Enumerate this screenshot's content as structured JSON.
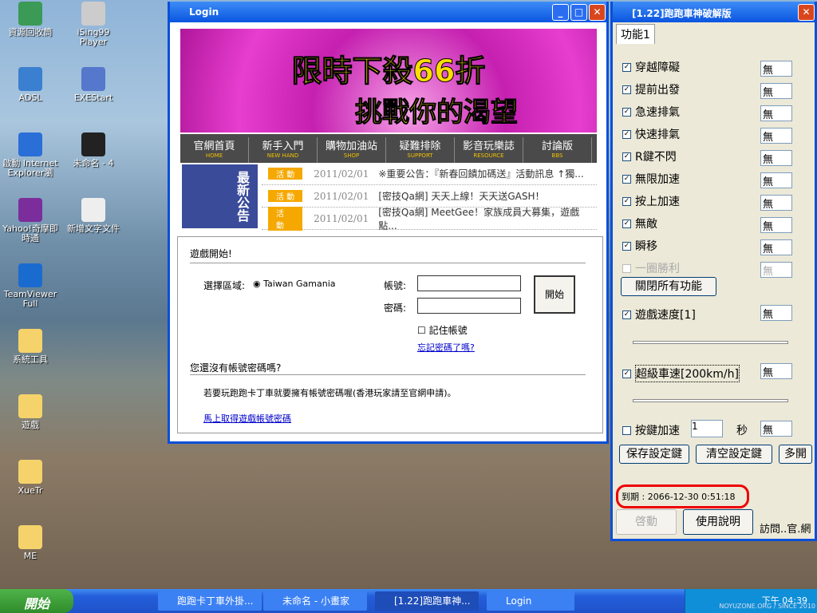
{
  "desktop_icons": [
    {
      "label": "資源回收筒"
    },
    {
      "label": "iSing99 Player"
    },
    {
      "label": "ADSL"
    },
    {
      "label": "EXEStart"
    },
    {
      "label": "啟動 Internet Explorer瀏"
    },
    {
      "label": "未命名 - 4"
    },
    {
      "label": "Yahoo!奇摩即時通"
    },
    {
      "label": "新增文字文件"
    },
    {
      "label": "TeamViewer Full"
    },
    {
      "label": "系統工具"
    },
    {
      "label": "遊戲"
    },
    {
      "label": "XueTr"
    },
    {
      "label": "ME"
    }
  ],
  "login": {
    "title": "Login",
    "banner_line1": "限時下殺66折",
    "banner_line2": "挑戰你的渴望",
    "nav": [
      {
        "zh": "官網首頁",
        "en": "HOME"
      },
      {
        "zh": "新手入門",
        "en": "NEW HAND"
      },
      {
        "zh": "購物加油站",
        "en": "SHOP"
      },
      {
        "zh": "疑難排除",
        "en": "SUPPORT"
      },
      {
        "zh": "影音玩樂誌",
        "en": "RESOURCE"
      },
      {
        "zh": "討論版",
        "en": "BBS"
      }
    ],
    "news_badge": "最新公告",
    "news": [
      {
        "tag": "活 動",
        "date": "2011/02/01",
        "text": "※重要公告：『新春回饋加碼送』活動訊息 ↑獨..."
      },
      {
        "tag": "活 動",
        "date": "2011/02/01",
        "text": "[密技Qa網] 天天上線！天天送GASH！"
      },
      {
        "tag": "活 動",
        "date": "2011/02/01",
        "text": "[密技Qa網] MeetGee！家族成員大募集，遊戲點..."
      }
    ],
    "section1": "遊戲開始!",
    "region_label": "選擇區域:",
    "region_value": "Taiwan Gamania",
    "account_label": "帳號:",
    "password_label": "密碼:",
    "start": "開始",
    "remember": "記住帳號",
    "forgot": "忘記密碼了嗎?",
    "section2": "您還沒有帳號密碼嗎?",
    "info": "若要玩跑跑卡丁車就要擁有帳號密碼喔(香港玩家請至官網申請)。",
    "signup": "馬上取得遊戲帳號密碼"
  },
  "tool": {
    "title": "[1.22]跑跑車神破解版",
    "tab": "功能1",
    "items": [
      {
        "label": "穿越障礙",
        "value": "無",
        "checked": true
      },
      {
        "label": "提前出發",
        "value": "無",
        "checked": true
      },
      {
        "label": "急速排氣",
        "value": "無",
        "checked": true
      },
      {
        "label": "快速排氣",
        "value": "無",
        "checked": true
      },
      {
        "label": "R鍵不閃",
        "value": "無",
        "checked": true
      },
      {
        "label": "無限加速",
        "value": "無",
        "checked": true
      },
      {
        "label": "按上加速",
        "value": "無",
        "checked": true
      },
      {
        "label": "無敵",
        "value": "無",
        "checked": true
      },
      {
        "label": "瞬移",
        "value": "無",
        "checked": true
      },
      {
        "label": "一圈勝利",
        "value": "無",
        "checked": false
      }
    ],
    "close_all": "關閉所有功能",
    "speed_label": "遊戲速度[1]",
    "speed_value": "無",
    "car_label": "超級車速[200km/h]",
    "car_value": "無",
    "key_label": "按鍵加速",
    "key_num": "1",
    "sec": "秒",
    "key_value": "無",
    "save": "保存設定鍵",
    "clear": "清空設定鍵",
    "multi": "多開",
    "expire": "到期 : 2066-12-30 0:51:18",
    "activate": "啓動",
    "manual": "使用說明",
    "visit": "訪問..官.網"
  },
  "taskbar": {
    "start": "開始",
    "tasks": [
      "跑跑卡丁車外掛...",
      "未命名 - 小畫家",
      "[1.22]跑跑車神...",
      "Login"
    ],
    "clock": "下午 04:39",
    "watermark": "NOYUZONE.ORG / SINCE 2010"
  }
}
